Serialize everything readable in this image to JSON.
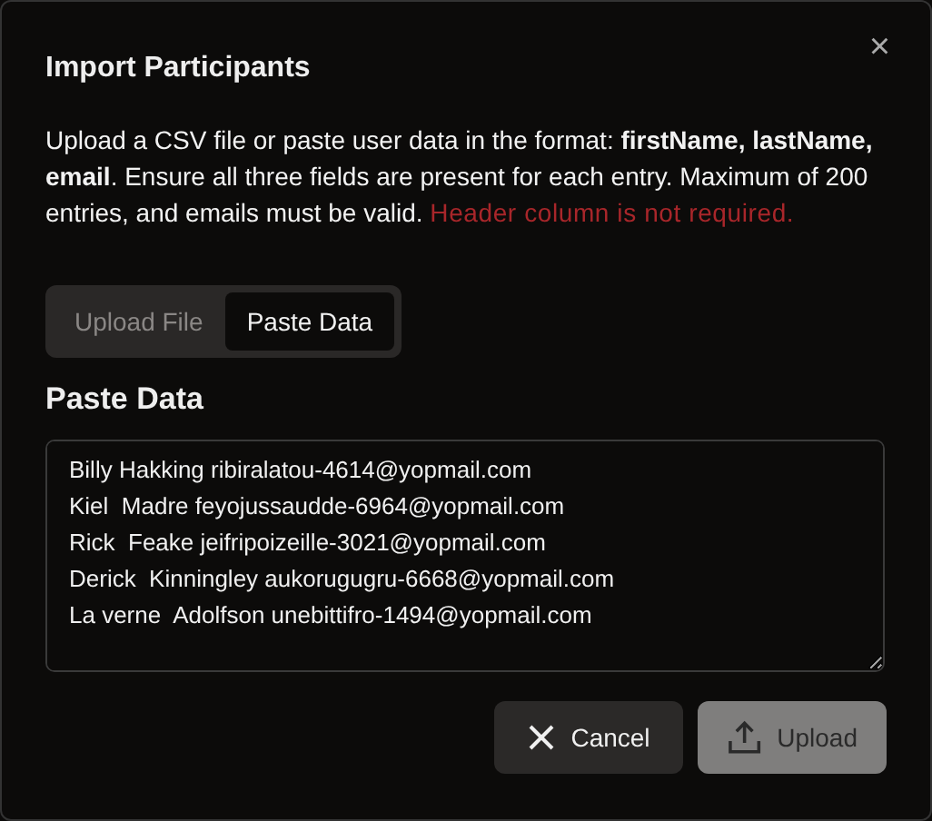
{
  "dialog": {
    "title": "Import Participants",
    "close": "×",
    "description": "Upload a CSV file or paste user data in the format: **firstName, lastName, email**. Ensure all three fields are present for each entry. Maximum of 200 entries, and emails must be valid.",
    "warning": "Header column is not required.",
    "tabs": [
      {
        "label": "Upload File",
        "selected": false
      },
      {
        "label": "Paste Data",
        "selected": true
      }
    ],
    "section_title": "Paste Data",
    "paste_field": {
      "value": "Billy Hakking ribiralatou-4614@yopmail.com\nKiel  Madre feyojussaudde-6964@yopmail.com\nRick  Feake jeifripoizeille-3021@yopmail.com\nDerick  Kinningley aukorugugru-6668@yopmail.com\nLa verne  Adolfson unebittifro-1494@yopmail.com\n"
    },
    "buttons": [
      {
        "kind": "cancel",
        "label": "Cancel",
        "disabled": false
      },
      {
        "kind": "upload",
        "label": "Upload",
        "disabled": true
      }
    ]
  }
}
